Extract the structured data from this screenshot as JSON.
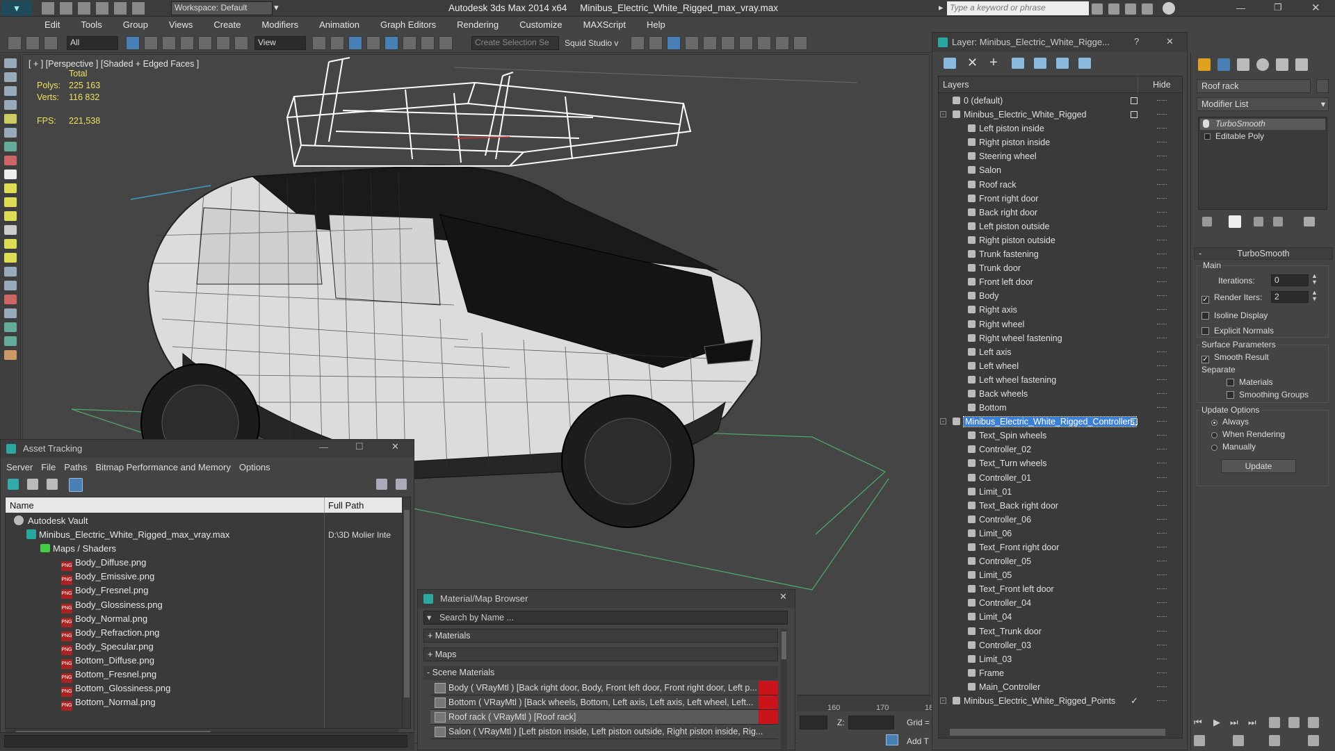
{
  "title": {
    "app": "Autodesk 3ds Max  2014 x64",
    "file": "Minibus_Electric_White_Rigged_max_vray.max",
    "workspace": "Workspace: Default",
    "search_placeholder": "Type a keyword or phrase"
  },
  "menu": [
    "Edit",
    "Tools",
    "Group",
    "Views",
    "Create",
    "Modifiers",
    "Animation",
    "Graph Editors",
    "Rendering",
    "Customize",
    "MAXScript",
    "Help"
  ],
  "toolbar": {
    "filter_value": "All",
    "refcoord_value": "View",
    "selection_set_placeholder": "Create Selection Se",
    "squid_label": "Squid Studio v"
  },
  "viewport": {
    "label": "[ + ] [Perspective ] [Shaded + Edged Faces ]",
    "stats": {
      "total_label": "Total",
      "polys_label": "Polys:",
      "polys_value": "225 163",
      "verts_label": "Verts:",
      "verts_value": "116 832",
      "fps_label": "FPS:",
      "fps_value": "221,538"
    }
  },
  "layers": {
    "title": "Layer: Minibus_Electric_White_Rigge...",
    "help": "?",
    "col_layers": "Layers",
    "col_hide": "Hide",
    "rows": [
      {
        "label": "0 (default)",
        "indent": 1,
        "type": "layer",
        "box": true
      },
      {
        "label": "Minibus_Electric_White_Rigged",
        "indent": 1,
        "type": "layer",
        "box": true,
        "expand": true
      },
      {
        "label": "Left piston inside",
        "indent": 2,
        "type": "obj"
      },
      {
        "label": "Right piston inside",
        "indent": 2,
        "type": "obj"
      },
      {
        "label": "Steering wheel",
        "indent": 2,
        "type": "obj"
      },
      {
        "label": "Salon",
        "indent": 2,
        "type": "obj"
      },
      {
        "label": "Roof rack",
        "indent": 2,
        "type": "obj"
      },
      {
        "label": "Front right door",
        "indent": 2,
        "type": "obj"
      },
      {
        "label": "Back right door",
        "indent": 2,
        "type": "obj"
      },
      {
        "label": "Left piston outside",
        "indent": 2,
        "type": "obj"
      },
      {
        "label": "Right piston outside",
        "indent": 2,
        "type": "obj"
      },
      {
        "label": "Trunk fastening",
        "indent": 2,
        "type": "obj"
      },
      {
        "label": "Trunk door",
        "indent": 2,
        "type": "obj"
      },
      {
        "label": "Front left door",
        "indent": 2,
        "type": "obj"
      },
      {
        "label": "Body",
        "indent": 2,
        "type": "obj"
      },
      {
        "label": "Right axis",
        "indent": 2,
        "type": "obj"
      },
      {
        "label": "Right wheel",
        "indent": 2,
        "type": "obj"
      },
      {
        "label": "Right wheel fastening",
        "indent": 2,
        "type": "obj"
      },
      {
        "label": "Left axis",
        "indent": 2,
        "type": "obj"
      },
      {
        "label": "Left wheel",
        "indent": 2,
        "type": "obj"
      },
      {
        "label": "Left wheel fastening",
        "indent": 2,
        "type": "obj"
      },
      {
        "label": "Back wheels",
        "indent": 2,
        "type": "obj"
      },
      {
        "label": "Bottom",
        "indent": 2,
        "type": "obj"
      },
      {
        "label": "Minibus_Electric_White_Rigged_Controllers",
        "indent": 1,
        "type": "layer",
        "box": true,
        "expand": true,
        "selected": true
      },
      {
        "label": "Text_Spin wheels",
        "indent": 2,
        "type": "obj"
      },
      {
        "label": "Controller_02",
        "indent": 2,
        "type": "obj"
      },
      {
        "label": "Text_Turn wheels",
        "indent": 2,
        "type": "obj"
      },
      {
        "label": "Controller_01",
        "indent": 2,
        "type": "obj"
      },
      {
        "label": "Limit_01",
        "indent": 2,
        "type": "obj"
      },
      {
        "label": "Text_Back right door",
        "indent": 2,
        "type": "obj"
      },
      {
        "label": "Controller_06",
        "indent": 2,
        "type": "obj"
      },
      {
        "label": "Limit_06",
        "indent": 2,
        "type": "obj"
      },
      {
        "label": "Text_Front right door",
        "indent": 2,
        "type": "obj"
      },
      {
        "label": "Controller_05",
        "indent": 2,
        "type": "obj"
      },
      {
        "label": "Limit_05",
        "indent": 2,
        "type": "obj"
      },
      {
        "label": "Text_Front left door",
        "indent": 2,
        "type": "obj"
      },
      {
        "label": "Controller_04",
        "indent": 2,
        "type": "obj"
      },
      {
        "label": "Limit_04",
        "indent": 2,
        "type": "obj"
      },
      {
        "label": "Text_Trunk door",
        "indent": 2,
        "type": "obj"
      },
      {
        "label": "Controller_03",
        "indent": 2,
        "type": "obj"
      },
      {
        "label": "Limit_03",
        "indent": 2,
        "type": "obj"
      },
      {
        "label": "Frame",
        "indent": 2,
        "type": "obj"
      },
      {
        "label": "Main_Controller",
        "indent": 2,
        "type": "obj"
      },
      {
        "label": "Minibus_Electric_White_Rigged_Points",
        "indent": 1,
        "type": "layer",
        "check": true,
        "expand": true
      }
    ]
  },
  "command_panel": {
    "object_name": "Roof rack",
    "modifier_list": "Modifier List",
    "stack": [
      "TurboSmooth",
      "Editable Poly"
    ],
    "rollout_title": "TurboSmooth",
    "main_label": "Main",
    "iterations_label": "Iterations:",
    "iterations_value": "0",
    "render_iters_label": "Render Iters:",
    "render_iters_value": "2",
    "isoline": "Isoline Display",
    "explicit_normals": "Explicit Normals",
    "surface_params": "Surface Parameters",
    "smooth_result": "Smooth Result",
    "separate": "Separate",
    "materials": "Materials",
    "smoothing_groups": "Smoothing Groups",
    "update_options": "Update Options",
    "always": "Always",
    "when_rendering": "When Rendering",
    "manually": "Manually",
    "update_button": "Update"
  },
  "asset_tracking": {
    "title": "Asset Tracking",
    "menu": [
      "Server",
      "File",
      "Paths",
      "Bitmap Performance and Memory",
      "Options"
    ],
    "col_name": "Name",
    "col_path": "Full Path",
    "rows": [
      {
        "label": "Autodesk Vault",
        "indent": 1,
        "kind": "vault",
        "path": ""
      },
      {
        "label": "Minibus_Electric_White_Rigged_max_vray.max",
        "indent": 2,
        "kind": "max",
        "path": "D:\\3D Molier Inte"
      },
      {
        "label": "Maps / Shaders",
        "indent": 3,
        "kind": "maps",
        "path": ""
      },
      {
        "label": "Body_Diffuse.png",
        "indent": 4,
        "kind": "png",
        "path": ""
      },
      {
        "label": "Body_Emissive.png",
        "indent": 4,
        "kind": "png",
        "path": ""
      },
      {
        "label": "Body_Fresnel.png",
        "indent": 4,
        "kind": "png",
        "path": ""
      },
      {
        "label": "Body_Glossiness.png",
        "indent": 4,
        "kind": "png",
        "path": ""
      },
      {
        "label": "Body_Normal.png",
        "indent": 4,
        "kind": "png",
        "path": ""
      },
      {
        "label": "Body_Refraction.png",
        "indent": 4,
        "kind": "png",
        "path": ""
      },
      {
        "label": "Body_Specular.png",
        "indent": 4,
        "kind": "png",
        "path": ""
      },
      {
        "label": "Bottom_Diffuse.png",
        "indent": 4,
        "kind": "png",
        "path": ""
      },
      {
        "label": "Bottom_Fresnel.png",
        "indent": 4,
        "kind": "png",
        "path": ""
      },
      {
        "label": "Bottom_Glossiness.png",
        "indent": 4,
        "kind": "png",
        "path": ""
      },
      {
        "label": "Bottom_Normal.png",
        "indent": 4,
        "kind": "png",
        "path": ""
      }
    ]
  },
  "material_browser": {
    "title": "Material/Map Browser",
    "search_placeholder": "Search by Name ...",
    "sections": [
      "+ Materials",
      "+ Maps",
      "- Scene Materials"
    ],
    "rows": [
      "Body  ( VRayMtl ) [Back right door, Body, Front left door, Front right door, Left p...",
      "Bottom  ( VRayMtl ) [Back wheels, Bottom, Left axis, Left axis, Left wheel, Left...",
      "Roof rack  ( VRayMtl ) [Roof rack]",
      "Salon  ( VRayMtl ) [Left piston inside, Left piston outside, Right piston inside, Rig..."
    ]
  },
  "timeline": {
    "ticks": [
      "160",
      "170",
      "18"
    ],
    "z_label": "Z:",
    "grid_label": "Grid =",
    "add_t": "Add T"
  }
}
